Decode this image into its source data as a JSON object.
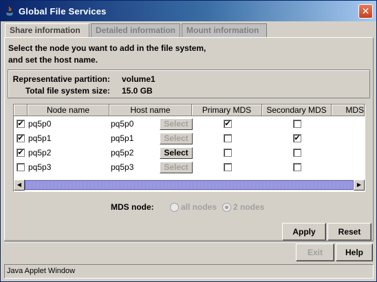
{
  "window": {
    "title": "Global File Services",
    "close_glyph": "✕"
  },
  "tabs": [
    {
      "label": "Share information",
      "active": true
    },
    {
      "label": "Detailed information",
      "active": false
    },
    {
      "label": "Mount information",
      "active": false
    }
  ],
  "instructions": {
    "line1": "Select the node you want to add in the file system,",
    "line2": "and set the host name."
  },
  "info": {
    "partition_label": "Representative partition:",
    "partition_value": "volume1",
    "size_label": "Total file system size:",
    "size_value": "15.0 GB"
  },
  "table": {
    "columns": [
      "",
      "Node name",
      "Host name",
      "Primary MDS",
      "Secondary MDS",
      "MDS"
    ],
    "rows": [
      {
        "checked": true,
        "node": "pq5p0",
        "host": "pq5p0",
        "select_label": "Select",
        "select_enabled": false,
        "primary": true,
        "secondary": false
      },
      {
        "checked": true,
        "node": "pq5p1",
        "host": "pq5p1",
        "select_label": "Select",
        "select_enabled": false,
        "primary": false,
        "secondary": true
      },
      {
        "checked": true,
        "node": "pq5p2",
        "host": "pq5p2",
        "select_label": "Select",
        "select_enabled": true,
        "primary": false,
        "secondary": false
      },
      {
        "checked": false,
        "node": "pq5p3",
        "host": "pq5p3",
        "select_label": "Select",
        "select_enabled": false,
        "primary": false,
        "secondary": false
      }
    ],
    "check_glyph": "✔"
  },
  "mds_node": {
    "label": "MDS node:",
    "options": [
      {
        "label": "all nodes",
        "selected": false
      },
      {
        "label": "2 nodes",
        "selected": true
      }
    ]
  },
  "buttons": {
    "apply": "Apply",
    "reset": "Reset",
    "exit": "Exit",
    "help": "Help"
  },
  "status": "Java Applet Window",
  "colors": {
    "title_start": "#0a246a",
    "title_end": "#a6caf0",
    "face": "#d4d0c8"
  }
}
